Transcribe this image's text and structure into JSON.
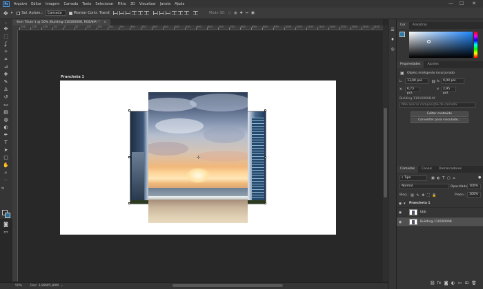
{
  "menubar": {
    "app_logo": "Ps",
    "items": [
      "Arquivo",
      "Editar",
      "Imagem",
      "Camada",
      "Texto",
      "Selecionar",
      "Filtro",
      "3D",
      "Visualizar",
      "Janela",
      "Ajuda"
    ],
    "win_min": "—",
    "win_max": "☐",
    "win_close": "✕"
  },
  "options": {
    "autoselect_label": "Sel. Autom.:",
    "autoselect_checked": false,
    "layer_select": "Camada",
    "transform_checked": true,
    "transform_label": "Mostrar Contr. Transf.",
    "mode_3d": "Modo 3D:"
  },
  "document": {
    "tab_title": "Sem Título-1 @ 50% (Building-110160008, RGB/8#) *",
    "tab_close": "×",
    "artboard_label": "Prancheta 1",
    "ruler_top": [
      "-200",
      "-150",
      "-100",
      "-50",
      "0",
      "50",
      "100",
      "150",
      "200",
      "250",
      "300",
      "350",
      "400",
      "450",
      "500",
      "550",
      "600",
      "650",
      "700",
      "750",
      "800",
      "850",
      "900",
      "950",
      "1000",
      "1050",
      "1100",
      "1150",
      "1200",
      "1250",
      "1300",
      "1350",
      "1400"
    ]
  },
  "status": {
    "zoom": "50%",
    "doc": "Doc: 3,89M/5,80M"
  },
  "color_panel": {
    "tabs": [
      "Cor",
      "Amostras"
    ],
    "fg_color": "#2e78a8",
    "bg_color": "#222222"
  },
  "properties": {
    "tabs": [
      "Propriedades",
      "Ajustes"
    ],
    "object_type": "Objeto inteligente incorporado",
    "w_label": "L:",
    "w_value": "13,00 pol.",
    "h_label": "A:",
    "h_value": "9,00 pol.",
    "x_label": "X:",
    "x_value": "6,73 pol.",
    "y_label": "Y:",
    "y_value": "2,95 pol.",
    "linked_name": "Building-110160008.tif",
    "comp_placeholder": "Não aplicar composição de camada",
    "edit_button": "Editar conteúdo",
    "convert_button": "Converter para vinculado..."
  },
  "layers_panel": {
    "tabs": [
      "Camadas",
      "Canais",
      "Demarcadores"
    ],
    "filter": "Tipo",
    "blend_mode": "Normal",
    "opacity_label": "Opacidade:",
    "opacity_value": "100%",
    "lock_label": "Bloq.:",
    "fill_label": "Preen.:",
    "fill_value": "100%",
    "layers": [
      {
        "name": "Prancheta 1",
        "type": "artboard"
      },
      {
        "name": "bbb",
        "type": "smart"
      },
      {
        "name": "Building-110160008",
        "type": "smart"
      }
    ]
  },
  "icons": {
    "move": "✥",
    "marquee": "⬚",
    "lasso": "ʆ",
    "wand": "✧",
    "crop": "⌗",
    "eyedrop": "⊿",
    "heal": "✚",
    "brush": "✎",
    "stamp": "♙",
    "history": "↺",
    "eraser": "▭",
    "gradient": "▤",
    "blur": "◍",
    "dodge": "◐",
    "pen": "✒",
    "type": "T",
    "path": "➤",
    "shape": "▢",
    "hand": "✋",
    "zoom": "⌕",
    "ellipsis": "···"
  }
}
